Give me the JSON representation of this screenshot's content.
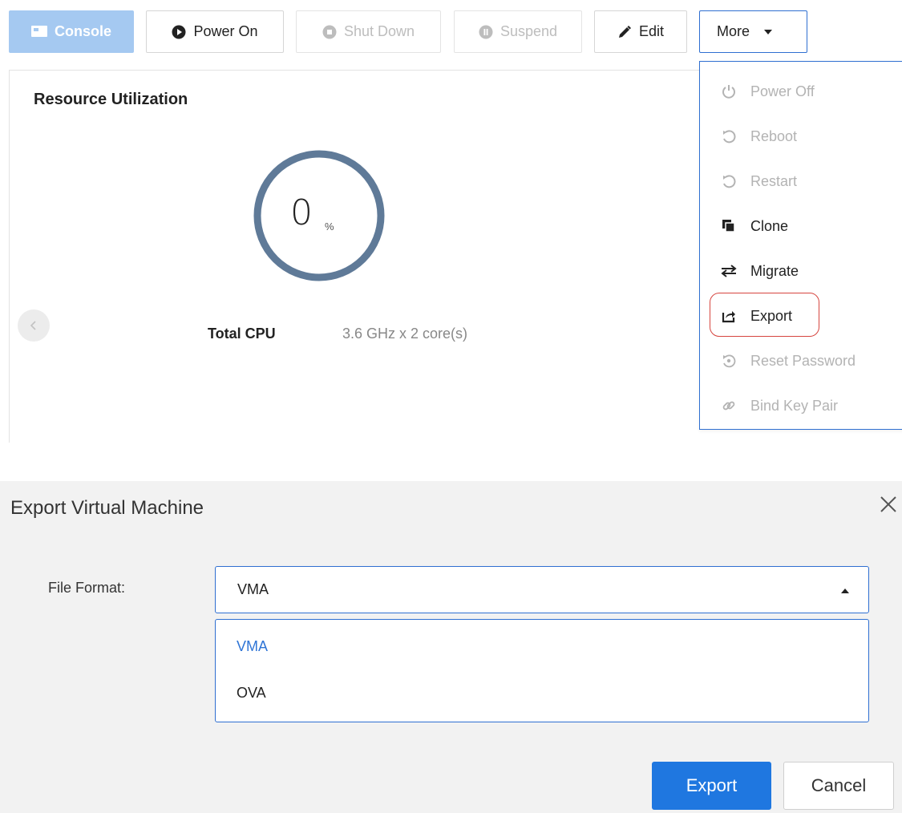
{
  "toolbar": {
    "console_label": "Console",
    "power_on_label": "Power On",
    "shut_down_label": "Shut Down",
    "suspend_label": "Suspend",
    "edit_label": "Edit",
    "more_label": "More"
  },
  "resource": {
    "title": "Resource Utilization",
    "cpu_percent": "0",
    "cpu_unit": "%",
    "total_cpu_label": "Total CPU",
    "total_cpu_value": "3.6 GHz x 2 core(s)"
  },
  "more_menu": {
    "items": [
      {
        "label": "Power Off",
        "icon": "power-icon",
        "enabled": false
      },
      {
        "label": "Reboot",
        "icon": "reboot-icon",
        "enabled": false
      },
      {
        "label": "Restart",
        "icon": "restart-icon",
        "enabled": false
      },
      {
        "label": "Clone",
        "icon": "clone-icon",
        "enabled": true
      },
      {
        "label": "Migrate",
        "icon": "migrate-icon",
        "enabled": true
      },
      {
        "label": "Export",
        "icon": "export-icon",
        "enabled": true,
        "highlighted": true
      },
      {
        "label": "Reset Password",
        "icon": "reset-password-icon",
        "enabled": false
      },
      {
        "label": "Bind Key Pair",
        "icon": "link-icon",
        "enabled": false
      }
    ]
  },
  "dialog": {
    "title": "Export Virtual Machine",
    "file_format_label": "File Format:",
    "selected_format": "VMA",
    "options": [
      "VMA",
      "OVA"
    ],
    "export_button": "Export",
    "cancel_button": "Cancel"
  },
  "colors": {
    "accent": "#1f77e0",
    "accent_border": "#2f6fd1",
    "gauge_ring": "#5f7a98",
    "highlight_circle": "#d6453f",
    "disabled_text": "#b3b3b3"
  }
}
